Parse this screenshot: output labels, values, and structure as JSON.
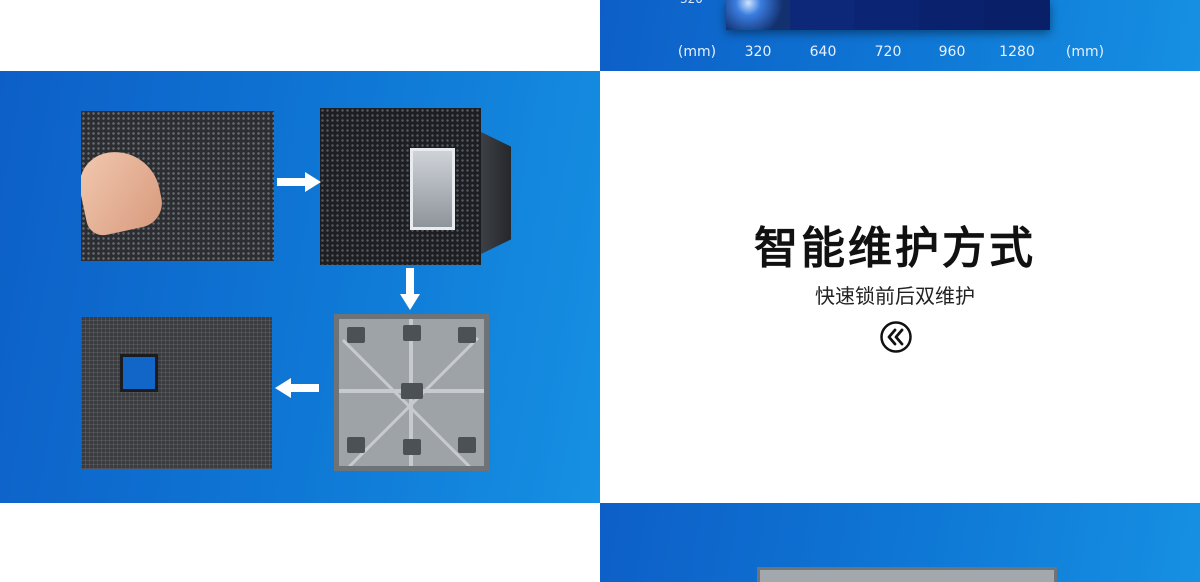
{
  "chart": {
    "y_tick": "320",
    "x_ticks": [
      "(mm)",
      "320",
      "640",
      "720",
      "960",
      "1280",
      "(mm)"
    ]
  },
  "feature": {
    "title": "智能维护方式",
    "subtitle": "快速锁前后双维护"
  },
  "icons": [
    "arrow-right-icon",
    "arrow-down-icon",
    "arrow-left-icon",
    "double-chevron-left-icon"
  ],
  "colors": {
    "accent_blue": "#0f78d6",
    "title_text": "#111111"
  }
}
